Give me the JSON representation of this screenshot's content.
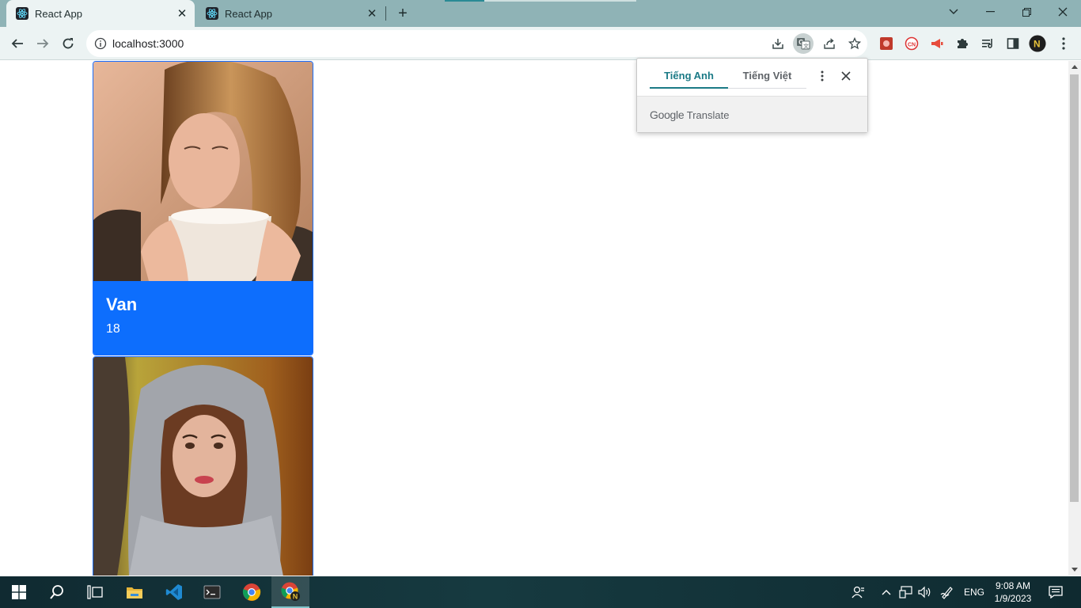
{
  "browser": {
    "tabs": [
      {
        "title": "React App",
        "active": true
      },
      {
        "title": "React App",
        "active": false
      }
    ],
    "url": "localhost:3000"
  },
  "translate_popup": {
    "source_language": "Tiếng Anh",
    "target_language": "Tiếng Việt",
    "brand_google": "Google",
    "brand_translate": "Translate"
  },
  "cards": [
    {
      "name": "Van",
      "age": "18",
      "photo": "woman-drinking-coffee-photo"
    },
    {
      "photo": "woman-in-fur-hood-photo"
    }
  ],
  "taskbar": {
    "language": "ENG",
    "time": "9:08 AM",
    "date": "1/9/2023"
  },
  "colors": {
    "card_accent": "#0d6efd",
    "tab_strip": "#8fb3b6",
    "toolbar": "#ecf3f3"
  }
}
